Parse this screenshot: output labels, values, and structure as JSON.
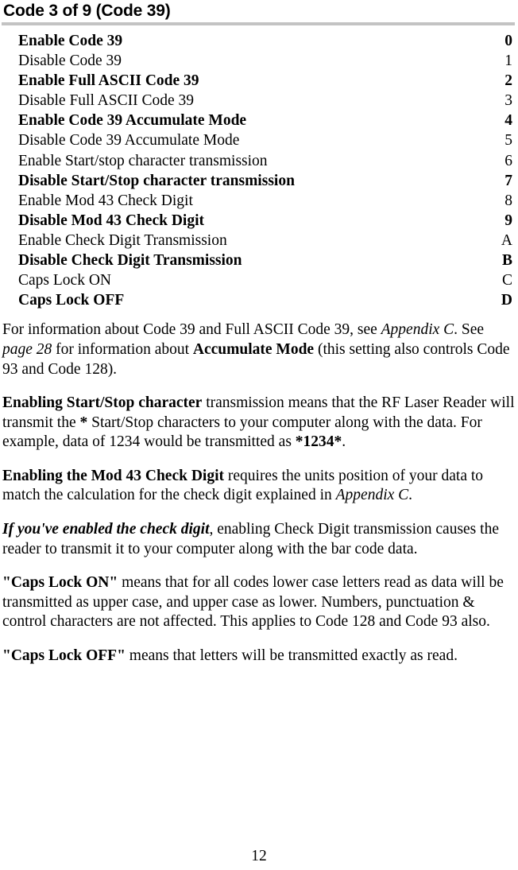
{
  "document": {
    "title": "Code 3 of 9 (Code 39)",
    "page_number": "12"
  },
  "options": {
    "items": [
      {
        "label": "Enable Code 39",
        "code": "0",
        "bold": true
      },
      {
        "label": "Disable Code 39",
        "code": "1",
        "bold": false
      },
      {
        "label": "Enable Full ASCII Code 39",
        "code": "2",
        "bold": true
      },
      {
        "label": "Disable Full ASCII Code 39",
        "code": "3",
        "bold": false
      },
      {
        "label": "Enable Code 39 Accumulate Mode",
        "code": "4",
        "bold": true
      },
      {
        "label": "Disable Code 39 Accumulate Mode",
        "code": "5",
        "bold": false
      },
      {
        "label": "Enable Start/stop character transmission",
        "code": "6",
        "bold": false
      },
      {
        "label": "Disable Start/Stop character transmission",
        "code": "7",
        "bold": true
      },
      {
        "label": "Enable Mod 43 Check Digit",
        "code": "8",
        "bold": false
      },
      {
        "label": "Disable Mod 43 Check Digit",
        "code": "9",
        "bold": true
      },
      {
        "label": "Enable Check Digit Transmission",
        "code": "A",
        "bold": false
      },
      {
        "label": "Disable Check Digit Transmission",
        "code": "B",
        "bold": true
      },
      {
        "label": "Caps Lock ON",
        "code": "C",
        "bold": false
      },
      {
        "label": "Caps Lock OFF",
        "code": "D",
        "bold": true
      }
    ]
  },
  "paragraphs": {
    "p1": {
      "s1": "For information about Code 39 and Full ASCII Code 39, see ",
      "s2": "Appendix C",
      "s3": ". See ",
      "s4": "page 28",
      "s5": " for information about ",
      "s6": "Accumulate Mode",
      "s7": " (this setting also controls Code 93 and Code 128)."
    },
    "p2": {
      "s1": "Enabling Start/Stop character",
      "s2": " transmission means that the RF Laser Reader will transmit the ",
      "s3": "*",
      "s4": " Start/Stop characters to your computer along with the data. For example, data of 1234 would be transmitted as ",
      "s5": "*1234*",
      "s6": "."
    },
    "p3": {
      "s1": "Enabling the Mod 43 Check Digit",
      "s2": " requires the units position of your data to match the calculation for the check digit explained in ",
      "s3": "Appendix C",
      "s4": "."
    },
    "p4": {
      "s1": "If you've enabled the check digit",
      "s2": ", enabling Check Digit transmission causes the reader to transmit it to your computer along with the bar code data."
    },
    "p5": {
      "s1": "\"Caps Lock ON\"",
      "s2": " means that for all codes lower case letters read as data will be transmitted as upper case, and upper case as lower.  Numbers, punctuation & control characters are not affected. This applies to Code 128 and Code 93 also."
    },
    "p6": {
      "s1": "\"Caps Lock OFF\"",
      "s2": " means that letters will be transmitted exactly as read."
    }
  }
}
